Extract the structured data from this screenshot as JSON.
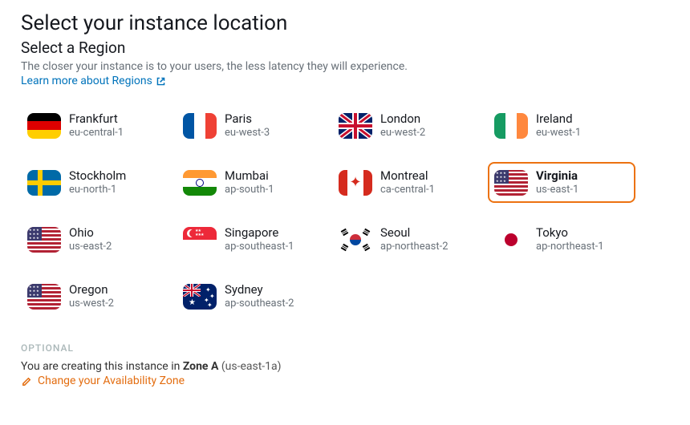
{
  "heading": "Select your instance location",
  "subheading": "Select a Region",
  "description": "The closer your instance is to your users, the less latency they will experience.",
  "learn_more_label": "Learn more about Regions",
  "regions": [
    {
      "name": "Frankfurt",
      "code": "eu-central-1",
      "flag": "de",
      "selected": false
    },
    {
      "name": "Paris",
      "code": "eu-west-3",
      "flag": "fr",
      "selected": false
    },
    {
      "name": "London",
      "code": "eu-west-2",
      "flag": "gb",
      "selected": false
    },
    {
      "name": "Ireland",
      "code": "eu-west-1",
      "flag": "ie",
      "selected": false
    },
    {
      "name": "Stockholm",
      "code": "eu-north-1",
      "flag": "se",
      "selected": false
    },
    {
      "name": "Mumbai",
      "code": "ap-south-1",
      "flag": "in",
      "selected": false
    },
    {
      "name": "Montreal",
      "code": "ca-central-1",
      "flag": "ca",
      "selected": false
    },
    {
      "name": "Virginia",
      "code": "us-east-1",
      "flag": "us",
      "selected": true
    },
    {
      "name": "Ohio",
      "code": "us-east-2",
      "flag": "us",
      "selected": false
    },
    {
      "name": "Singapore",
      "code": "ap-southeast-1",
      "flag": "sg",
      "selected": false
    },
    {
      "name": "Seoul",
      "code": "ap-northeast-2",
      "flag": "kr",
      "selected": false
    },
    {
      "name": "Tokyo",
      "code": "ap-northeast-1",
      "flag": "jp",
      "selected": false
    },
    {
      "name": "Oregon",
      "code": "us-west-2",
      "flag": "us",
      "selected": false
    },
    {
      "name": "Sydney",
      "code": "ap-southeast-2",
      "flag": "au",
      "selected": false
    }
  ],
  "optional_label": "OPTIONAL",
  "zone_sentence_prefix": "You are creating this instance in ",
  "zone_name": "Zone A",
  "zone_code_paren": "(us-east-1a)",
  "change_zone_label": "Change your Availability Zone"
}
